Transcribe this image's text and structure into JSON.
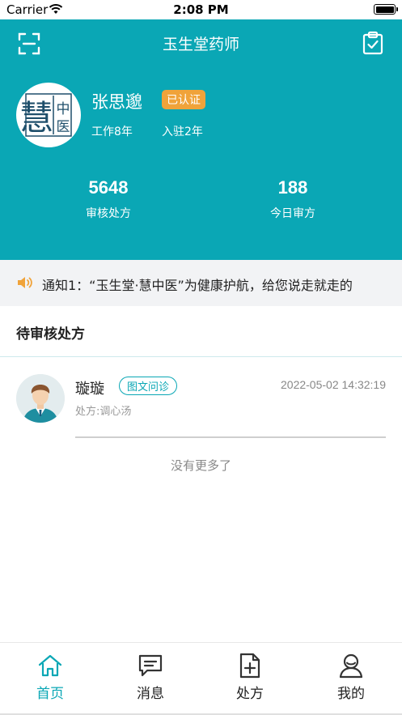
{
  "status_bar": {
    "carrier": "Carrier",
    "time": "2:08 PM"
  },
  "header": {
    "title": "玉生堂药师",
    "scan_icon": "scan-icon",
    "clipboard_icon": "clipboard-check-icon"
  },
  "profile": {
    "logo_text_main": "慧",
    "logo_text_a": "中",
    "logo_text_b": "医",
    "name": "张思邈",
    "badge": "已认证",
    "work_years": "工作8年",
    "join_years": "入驻2年"
  },
  "stats": [
    {
      "value": "5648",
      "label": "审核处方"
    },
    {
      "value": "188",
      "label": "今日审方"
    }
  ],
  "notice": {
    "icon": "speaker-icon",
    "text": "通知1：“玉生堂·慧中医”为健康护航，给您说走就走的"
  },
  "section": {
    "title": "待审核处方"
  },
  "prescriptions": [
    {
      "patient": "璇璇",
      "tag": "图文问诊",
      "time": "2022-05-02 14:32:19",
      "content": "处方:调心汤"
    }
  ],
  "no_more": "没有更多了",
  "tabs": [
    {
      "label": "首页",
      "icon": "home-icon",
      "active": true
    },
    {
      "label": "消息",
      "icon": "message-icon",
      "active": false
    },
    {
      "label": "处方",
      "icon": "prescription-icon",
      "active": false
    },
    {
      "label": "我的",
      "icon": "user-icon",
      "active": false
    }
  ],
  "colors": {
    "primary": "#0aa7b5",
    "badge": "#f0a33a",
    "notice_bg": "#f2f3f5"
  }
}
